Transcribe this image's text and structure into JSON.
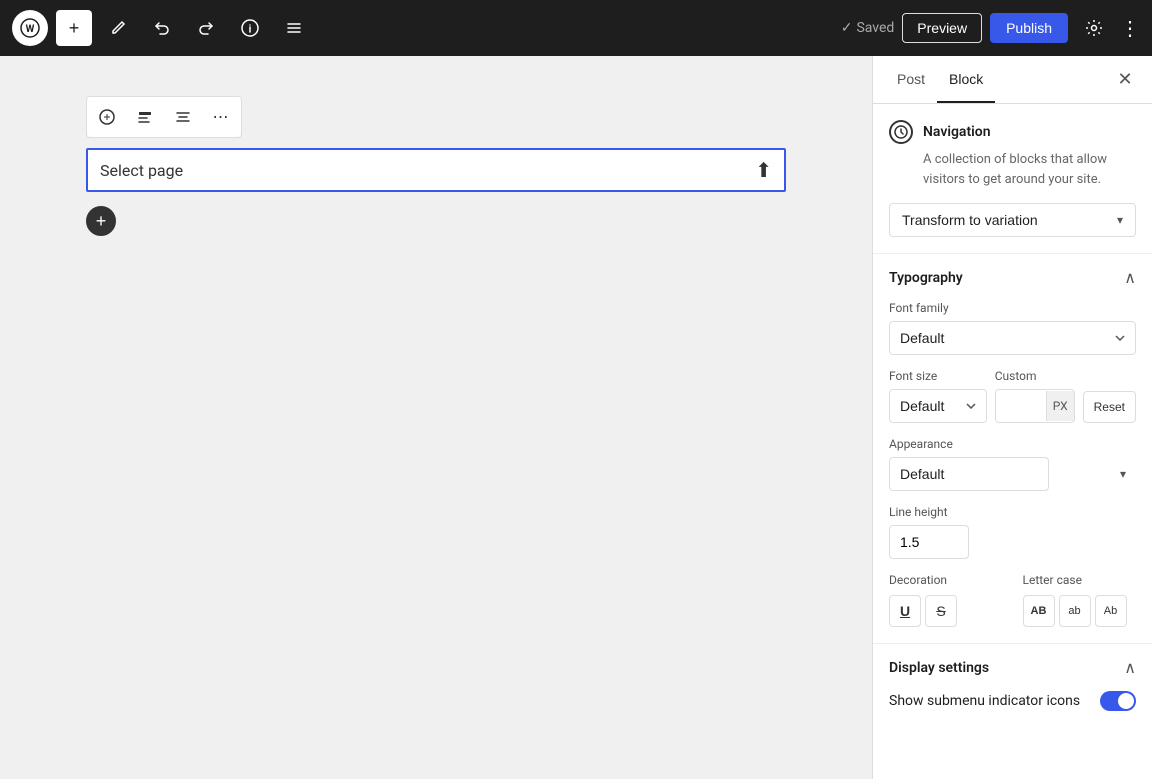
{
  "topbar": {
    "wp_logo": "W",
    "add_label": "+",
    "undo_icon": "↩",
    "redo_icon": "↪",
    "info_icon": "ℹ",
    "list_icon": "≡",
    "saved_text": "Saved",
    "preview_label": "Preview",
    "publish_label": "Publish",
    "settings_icon": "⚙",
    "more_icon": "⋮"
  },
  "sidebar": {
    "tab_post": "Post",
    "tab_block": "Block",
    "close_icon": "✕",
    "navigation": {
      "title": "Navigation",
      "description": "A collection of blocks that allow visitors to get around your site.",
      "transform_label": "Transform to variation",
      "transform_chevron": "▾"
    },
    "typography": {
      "title": "Typography",
      "toggle_icon": "∧",
      "font_family_label": "Font family",
      "font_family_default": "Default",
      "font_size_label": "Font size",
      "font_size_default": "Default",
      "custom_label": "Custom",
      "custom_placeholder": "",
      "custom_unit": "PX",
      "reset_label": "Reset",
      "appearance_label": "Appearance",
      "appearance_default": "Default",
      "line_height_label": "Line height",
      "line_height_value": "1.5",
      "decoration_label": "Decoration",
      "deco_u": "U",
      "deco_s": "S̶",
      "letter_case_label": "Letter case",
      "case_upper": "AB",
      "case_lower": "ab",
      "case_title": "Ab"
    },
    "display_settings": {
      "title": "Display settings",
      "toggle_icon": "∧",
      "submenu_label": "Show submenu indicator icons",
      "submenu_toggle": true
    }
  },
  "canvas": {
    "select_page_text": "Select page",
    "add_block_icon": "+"
  }
}
